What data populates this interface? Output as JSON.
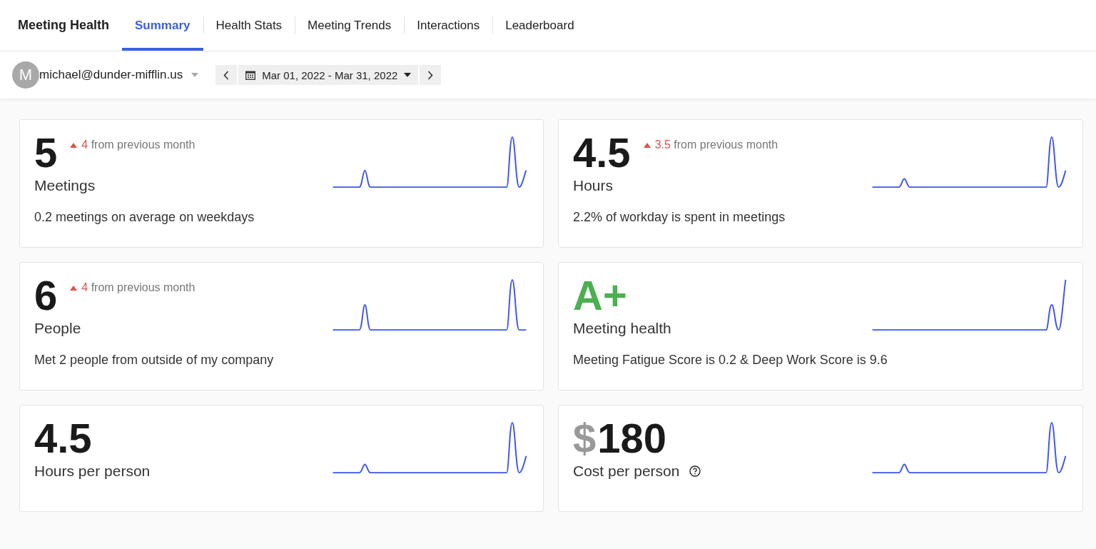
{
  "app_title": "Meeting Health",
  "tabs": [
    {
      "label": "Summary",
      "selected": true
    },
    {
      "label": "Health Stats",
      "selected": false
    },
    {
      "label": "Meeting Trends",
      "selected": false
    },
    {
      "label": "Interactions",
      "selected": false
    },
    {
      "label": "Leaderboard",
      "selected": false
    }
  ],
  "user": {
    "avatar_letter": "M",
    "email": "michael@dunder-mifflin.us"
  },
  "date_range": {
    "label": "Mar 01, 2022 - Mar 31, 2022"
  },
  "cards": [
    {
      "kind": "number",
      "value": "5",
      "delta": {
        "amount": "4",
        "text": "from previous month"
      },
      "label": "Meetings",
      "description": "0.2 meetings on average on weekdays",
      "help": false
    },
    {
      "kind": "number",
      "value": "4.5",
      "delta": {
        "amount": "3.5",
        "text": "from previous month"
      },
      "label": "Hours",
      "description": "2.2% of workday is spent in meetings",
      "help": false
    },
    {
      "kind": "number",
      "value": "6",
      "delta": {
        "amount": "4",
        "text": "from previous month"
      },
      "label": "People",
      "description": "Met 2 people from outside of my company",
      "help": false
    },
    {
      "kind": "grade",
      "value": "A+",
      "label": "Meeting health",
      "description": "Meeting Fatigue Score is 0.2 & Deep Work Score is 9.6",
      "help": false
    },
    {
      "kind": "number",
      "value": "4.5",
      "label": "Hours per person",
      "help": false
    },
    {
      "kind": "money",
      "prefix": "$",
      "value": "180",
      "label": "Cost per person",
      "help": true
    }
  ]
}
